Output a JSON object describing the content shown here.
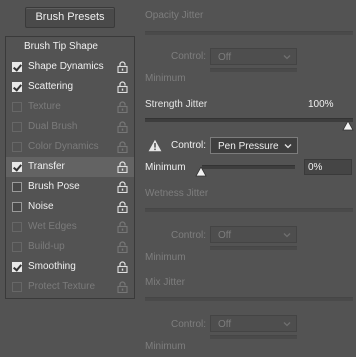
{
  "presets_button": "Brush Presets",
  "list": {
    "header": "Brush Tip Shape",
    "items": [
      {
        "label": "Shape Dynamics",
        "checked": true,
        "enabled": true
      },
      {
        "label": "Scattering",
        "checked": true,
        "enabled": true
      },
      {
        "label": "Texture",
        "checked": false,
        "enabled": false
      },
      {
        "label": "Dual Brush",
        "checked": false,
        "enabled": false
      },
      {
        "label": "Color Dynamics",
        "checked": false,
        "enabled": false
      },
      {
        "label": "Transfer",
        "checked": true,
        "enabled": true,
        "selected": true
      },
      {
        "label": "Brush Pose",
        "checked": false,
        "enabled": true
      },
      {
        "label": "Noise",
        "checked": false,
        "enabled": true
      },
      {
        "label": "Wet Edges",
        "checked": false,
        "enabled": false
      },
      {
        "label": "Build-up",
        "checked": false,
        "enabled": false
      },
      {
        "label": "Smoothing",
        "checked": true,
        "enabled": true
      },
      {
        "label": "Protect Texture",
        "checked": false,
        "enabled": false
      }
    ]
  },
  "opacity": {
    "title": "Opacity Jitter",
    "control_label": "Control:",
    "control_value": "Off",
    "minimum_label": "Minimum"
  },
  "strength": {
    "title": "Strength Jitter",
    "value": "100%",
    "control_label": "Control:",
    "control_value": "Pen Pressure",
    "minimum_label": "Minimum",
    "minimum_value": "0%"
  },
  "wetness": {
    "title": "Wetness Jitter",
    "control_label": "Control:",
    "control_value": "Off",
    "minimum_label": "Minimum"
  },
  "mix": {
    "title": "Mix Jitter",
    "control_label": "Control:",
    "control_value": "Off",
    "minimum_label": "Minimum"
  },
  "icons": {
    "warning": "warning-icon",
    "lock": "lock-icon",
    "chevron": "chevron-down-icon"
  },
  "colors": {
    "background": "#535353",
    "selected_row": "#636363",
    "disabled_text": "#7b7b7b"
  }
}
